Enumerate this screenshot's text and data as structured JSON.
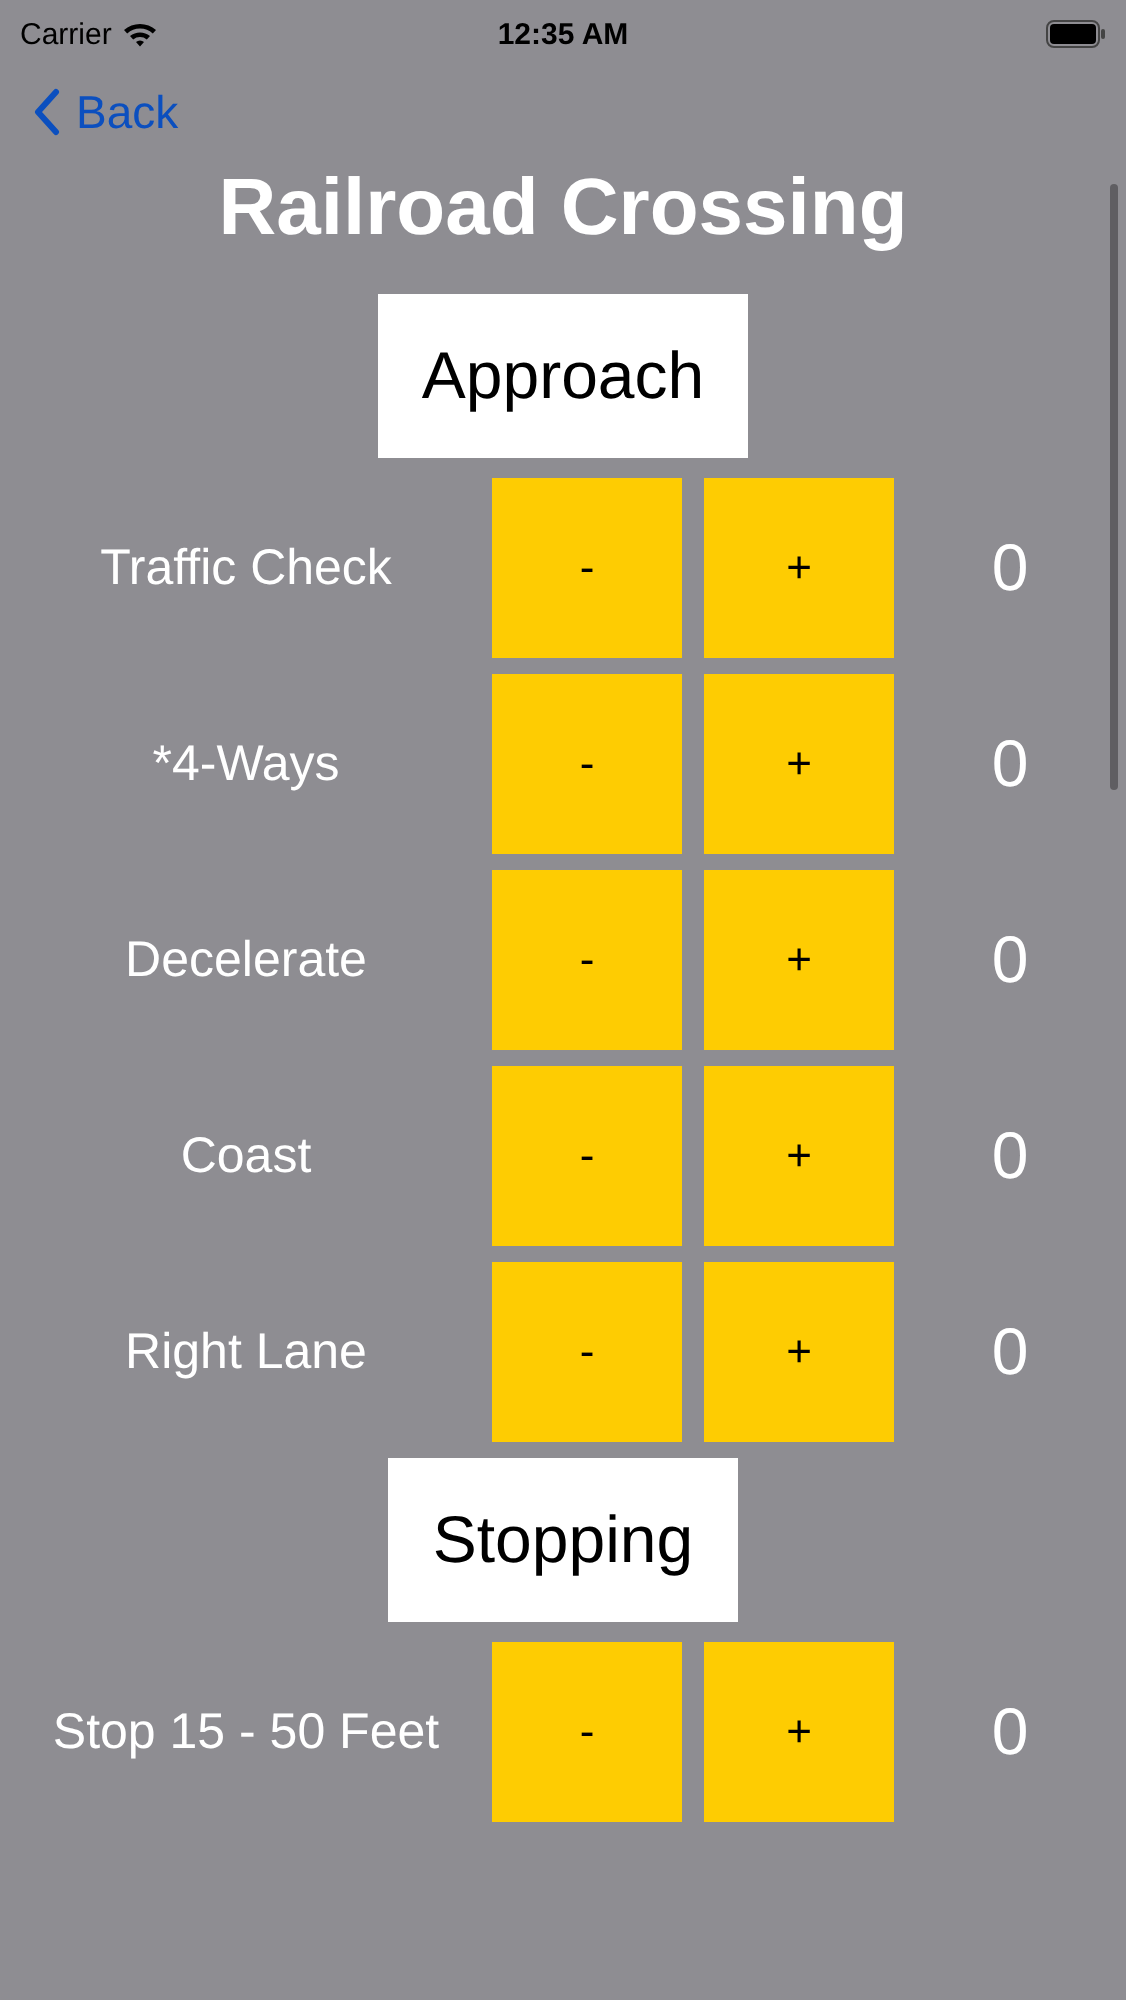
{
  "status_bar": {
    "carrier": "Carrier",
    "time": "12:35 AM"
  },
  "nav": {
    "back": "Back"
  },
  "title": "Railroad Crossing",
  "sections": [
    {
      "heading": "Approach",
      "rows": [
        {
          "label": "Traffic Check",
          "minus": "-",
          "plus": "+",
          "count": "0"
        },
        {
          "label": "*4-Ways",
          "minus": "-",
          "plus": "+",
          "count": "0"
        },
        {
          "label": "Decelerate",
          "minus": "-",
          "plus": "+",
          "count": "0"
        },
        {
          "label": "Coast",
          "minus": "-",
          "plus": "+",
          "count": "0"
        },
        {
          "label": "Right Lane",
          "minus": "-",
          "plus": "+",
          "count": "0"
        }
      ]
    },
    {
      "heading": "Stopping",
      "rows": [
        {
          "label": "Stop 15 - 50 Feet",
          "minus": "-",
          "plus": "+",
          "count": "0"
        }
      ]
    }
  ]
}
